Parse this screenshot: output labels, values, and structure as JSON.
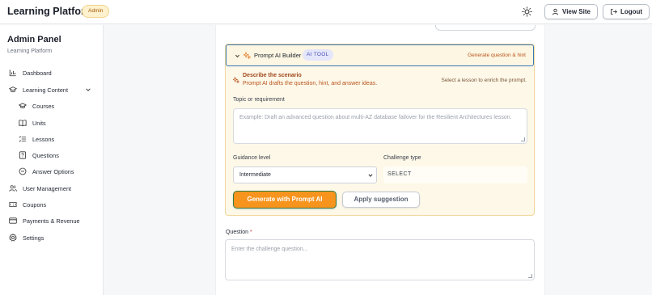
{
  "header": {
    "brand": "Learning Platform",
    "badge": "Admin",
    "theme_icon": "sun-icon",
    "view_site_label": "View Site",
    "logout_label": "Logout"
  },
  "sidebar": {
    "title": "Admin Panel",
    "subtitle": "Learning Platform",
    "items": [
      {
        "label": "Dashboard",
        "icon": "chart-icon"
      },
      {
        "label": "Learning Content",
        "icon": "graduation-cap-icon"
      },
      {
        "label": "Courses",
        "icon": "cap-icon"
      },
      {
        "label": "Units",
        "icon": "book-open-icon"
      },
      {
        "label": "Lessons",
        "icon": "list-icon"
      },
      {
        "label": "Questions",
        "icon": "question-doc-icon"
      },
      {
        "label": "Answer Options",
        "icon": "circle-minus-icon"
      },
      {
        "label": "User Management",
        "icon": "users-icon"
      },
      {
        "label": "Coupons",
        "icon": "ticket-icon"
      },
      {
        "label": "Payments & Revenue",
        "icon": "credit-card-icon"
      },
      {
        "label": "Settings",
        "icon": "gear-icon"
      }
    ]
  },
  "builder": {
    "title": "Prompt AI Builder",
    "tag": "AI TOOL",
    "header_hint": "Generate question & hint",
    "desc_title": "Describe the scenario",
    "desc_subtitle": "Prompt AI drafts the question, hint, and answer ideas.",
    "desc_hint": "Select a lesson to enrich the prompt.",
    "topic_label": "Topic or requirement",
    "topic_placeholder": "Example: Draft an advanced question about multi-AZ database failover for the Resilient Architectures lesson.",
    "guidance_label": "Guidance level",
    "guidance_value": "Intermediate",
    "challenge_label": "Challenge type",
    "challenge_value": "SELECT",
    "generate_label": "Generate with Prompt AI",
    "apply_label": "Apply suggestion"
  },
  "question": {
    "label": "Question",
    "required_mark": "*",
    "placeholder": "Enter the challenge question..."
  },
  "colors": {
    "accent_orange": "#f7941d",
    "card_bg": "#fdf8e8",
    "ai_tag": "#4a4fb8",
    "focus_border": "#3b78b6"
  }
}
